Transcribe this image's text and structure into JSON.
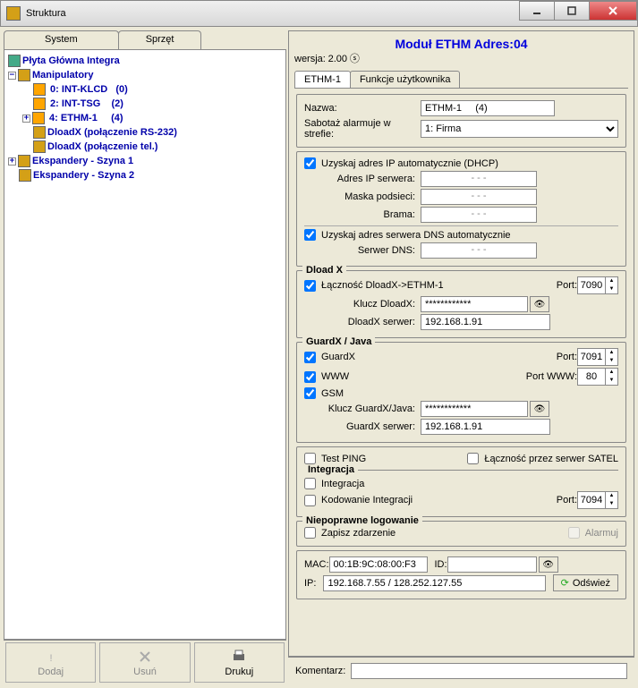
{
  "window": {
    "title": "Struktura"
  },
  "leftTabs": {
    "system": "System",
    "hardware": "Sprzęt"
  },
  "tree": {
    "root": "Płyta Główna Integra",
    "manip": "Manipulatory",
    "items": [
      {
        "label": " 0: INT-KLCD   (0)"
      },
      {
        "label": " 2: INT-TSG    (2)"
      },
      {
        "label": " 4: ETHM-1     (4)",
        "sel": true
      },
      {
        "label": "DloadX (połączenie RS-232)"
      },
      {
        "label": "DloadX (połączenie tel.)"
      }
    ],
    "exp1": "Ekspandery - Szyna 1",
    "exp2": "Ekspandery - Szyna 2"
  },
  "toolbar": {
    "add": "Dodaj",
    "del": "Usuń",
    "print": "Drukuj"
  },
  "module": {
    "title": "Moduł ETHM Adres:04",
    "version_lbl": "wersja:",
    "version": "2.00",
    "tabs": {
      "ethm": "ETHM-1",
      "userfn": "Funkcje użytkownika"
    },
    "name_lbl": "Nazwa:",
    "name_val": "ETHM-1     (4)",
    "sabot_lbl": "Sabotaż alarmuje w strefie:",
    "sabot_val": "1: Firma",
    "dhcp": "Uzyskaj adres IP automatycznie (DHCP)",
    "ip_lbl": "Adres IP serwera:",
    "mask_lbl": "Maska podsieci:",
    "gw_lbl": "Brama:",
    "dns_auto": "Uzyskaj adres serwera DNS automatycznie",
    "dns_lbl": "Serwer DNS:",
    "dotted": "-       -       -",
    "dloadx": {
      "title": "Dload X",
      "conn": "Łączność DloadX->ETHM-1",
      "port_lbl": "Port:",
      "port": "7090",
      "key_lbl": "Klucz DloadX:",
      "key": "************",
      "srv_lbl": "DloadX serwer:",
      "srv": "192.168.1.91"
    },
    "guardx": {
      "title": "GuardX / Java",
      "gx": "GuardX",
      "www": "WWW",
      "gsm": "GSM",
      "port_lbl": "Port:",
      "port": "7091",
      "portwww_lbl": "Port WWW:",
      "portwww": "80",
      "key_lbl": "Klucz GuardX/Java:",
      "key": "************",
      "srv_lbl": "GuardX serwer:",
      "srv": "192.168.1.91"
    },
    "testping": "Test PING",
    "satel": "Łączność przez serwer SATEL",
    "integ": {
      "title": "Integracja",
      "integ": "Integracja",
      "coding": "Kodowanie Integracji",
      "port_lbl": "Port:",
      "port": "7094"
    },
    "badlogin": {
      "title": "Niepoprawne logowanie",
      "save": "Zapisz zdarzenie",
      "alarm": "Alarmuj"
    },
    "mac_lbl": "MAC:",
    "mac": "00:1B:9C:08:00:F3",
    "id_lbl": "ID:",
    "id": "",
    "ip_addr_lbl": "IP:",
    "ip_addr": "192.168.7.55 / 128.252.127.55",
    "refresh": "Odśwież",
    "comment_lbl": "Komentarz:",
    "comment": ""
  }
}
